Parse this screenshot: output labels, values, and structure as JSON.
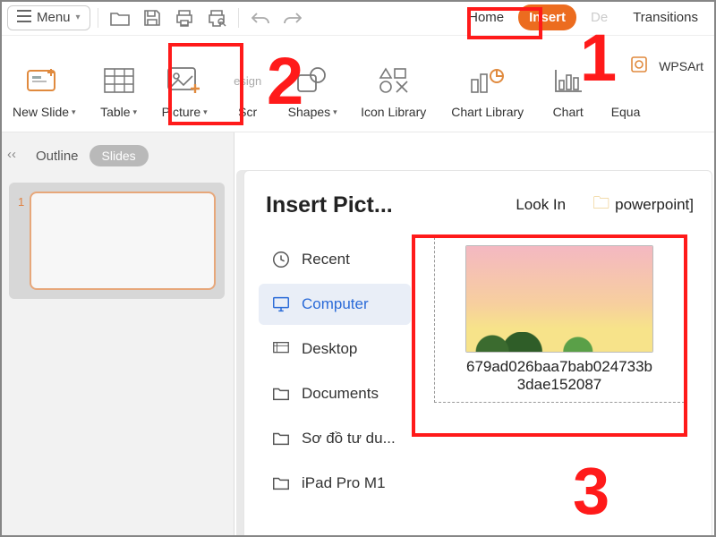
{
  "rowA": {
    "menu_label": "Menu",
    "tabs": {
      "home": "Home",
      "insert": "Insert",
      "design": "De",
      "transitions": "Transitions"
    }
  },
  "ribbon": {
    "new_slide": "New Slide",
    "table": "Table",
    "picture": "Picture",
    "screenshot": "Scr",
    "shapes": "Shapes",
    "icon_library": "Icon Library",
    "chart_library": "Chart Library",
    "chart": "Chart",
    "equation": "Equa",
    "wpsart": "WPSArt",
    "design_frag": "esign"
  },
  "leftpane": {
    "outline": "Outline",
    "slides": "Slides",
    "slide_number": "1"
  },
  "dialog": {
    "title": "Insert Pict...",
    "look_in": "Look In",
    "folder": "powerpoint]",
    "places": {
      "recent": "Recent",
      "computer": "Computer",
      "desktop": "Desktop",
      "documents": "Documents",
      "custom1": "Sơ đồ tư du...",
      "custom2": "iPad Pro M1"
    },
    "file": {
      "name_l1": "679ad026baa7bab024733b",
      "name_l2": "3dae152087"
    }
  },
  "annotations": {
    "one": "1",
    "two": "2",
    "three": "3"
  }
}
